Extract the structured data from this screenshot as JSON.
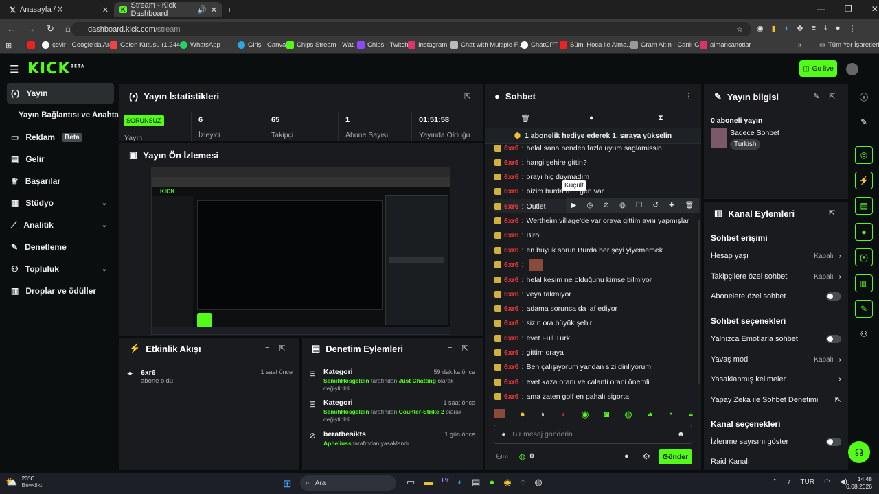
{
  "browser": {
    "tabs": [
      {
        "label": "Anasayfa / X"
      },
      {
        "label": "Stream - Kick Dashboard"
      }
    ],
    "url_domain": "dashboard.kick.com",
    "url_path": "/stream",
    "bookmarks": [
      "çevir - Google'da Ara",
      "Gelen Kutusu (1.244...",
      "WhatsApp",
      "Giriş - Canva",
      "Chips Stream - Wat...",
      "Chips - Twitch",
      "Instagram",
      "Chat with Multiple F...",
      "ChatGPT",
      "Sümi Hoca ile Alma...",
      "Gram Altın - Canlı G...",
      "almancanotlar"
    ],
    "bookmarks_right": "Tüm Yer İşaretleri"
  },
  "header": {
    "logo": "KICK",
    "logo_sup": "BETA",
    "go_live": "Go live"
  },
  "sidebar": {
    "items": [
      {
        "label": "Yayın"
      },
      {
        "label": "Yayın Bağlantısı ve Anahtarı"
      },
      {
        "label": "Reklam",
        "badge": "Beta"
      },
      {
        "label": "Gelir"
      },
      {
        "label": "Başarılar"
      },
      {
        "label": "Stüdyo"
      },
      {
        "label": "Analitik"
      },
      {
        "label": "Denetleme"
      },
      {
        "label": "Topluluk"
      },
      {
        "label": "Droplar ve ödüller"
      }
    ]
  },
  "stats": {
    "title": "Yayın İstatistikleri",
    "status_badge": "SORUNSUZ",
    "status_label": "Yayın",
    "items": [
      {
        "value": "6",
        "label": "İzleyici"
      },
      {
        "value": "65",
        "label": "Takipçi"
      },
      {
        "value": "1",
        "label": "Abone Sayısı"
      },
      {
        "value": "01:51:58",
        "label": "Yayında Olduğu"
      }
    ]
  },
  "preview": {
    "title": "Yayın Ön İzlemesi"
  },
  "activity": {
    "title": "Etkinlik Akışı",
    "items": [
      {
        "user": "6xr6",
        "action": "abone oldu",
        "time": "1 saat önce"
      }
    ]
  },
  "moderation": {
    "title": "Denetim Eylemleri",
    "items": [
      {
        "title": "Kategori",
        "time": "59 dakika önce",
        "actor": "SemihHosgeldin",
        "mid": "tarafından",
        "target": "Just Chatting",
        "rest": "olarak",
        "last": "değiştirildi"
      },
      {
        "title": "Kategori",
        "time": "1 saat önce",
        "actor": "SemihHosgeldin",
        "mid": "tarafından",
        "target": "Counter-Strike 2",
        "rest": "olarak",
        "last": "değiştirildi"
      },
      {
        "title": "beratbesikts",
        "time": "1 gün önce",
        "actor": "Apheliuss",
        "mid": "tarafından yasaklandı",
        "target": "",
        "rest": "",
        "last": ""
      }
    ]
  },
  "chat": {
    "title": "Sohbet",
    "pinned": "1 abonelik hediye ederek 1. sıraya yükselin",
    "tooltip": "Küçült",
    "messages": [
      {
        "user": "6xr6",
        "text": "helal sana benden fazla uyum saglamissin"
      },
      {
        "user": "6xr6",
        "text": "hangi şehire gittin?"
      },
      {
        "user": "6xr6",
        "text": "orayı hiç duymadım"
      },
      {
        "user": "6xr6",
        "text": "bizim burda m... gen var"
      },
      {
        "user": "6xr6",
        "text": "Outlet"
      },
      {
        "user": "6xr6",
        "text": "Wertheim village'de var oraya gittim aynı yapmışlar"
      },
      {
        "user": "6xr6",
        "text": "Birol"
      },
      {
        "user": "6xr6",
        "text": "en büyük sorun Burda her şeyi yiyememek"
      },
      {
        "user": "6xr6",
        "text": ""
      },
      {
        "user": "6xr6",
        "text": "helal kesim ne olduğunu kimse bilmiyor"
      },
      {
        "user": "6xr6",
        "text": "veya takmıyor"
      },
      {
        "user": "6xr6",
        "text": "adama sorunca da laf ediyor"
      },
      {
        "user": "6xr6",
        "text": "sizin ora büyük şehir"
      },
      {
        "user": "6xr6",
        "text": "evet Full Türk"
      },
      {
        "user": "6xr6",
        "text": "gittim oraya"
      },
      {
        "user": "6xr6",
        "text": "Ben çalışıyorum yandan sizi dinliyorum"
      },
      {
        "user": "6xr6",
        "text": "evet kaza oranı ve calanti orani önemli"
      },
      {
        "user": "6xr6",
        "text": "ama zaten golf en pahalı sigorta"
      }
    ],
    "input_placeholder": "Bir mesaj gönderin",
    "points": "0",
    "send": "Gönder"
  },
  "info": {
    "title": "Yayın bilgisi",
    "subs": "0 aboneli yayın",
    "stream_title": "Sadece Sohbet",
    "language": "Turkish"
  },
  "actions": {
    "title": "Kanal Eylemleri",
    "chat_access": "Sohbet erişimi",
    "rows1": [
      {
        "label": "Hesap yaşı",
        "value": "Kapalı",
        "kind": "chev"
      },
      {
        "label": "Takipçilere özel sohbet",
        "value": "Kapalı",
        "kind": "chev"
      },
      {
        "label": "Abonelere özel sohbet",
        "value": "",
        "kind": "toggle"
      }
    ],
    "chat_options": "Sohbet seçenekleri",
    "rows2": [
      {
        "label": "Yalnızca Emotlarla sohbet",
        "value": "",
        "kind": "toggle"
      },
      {
        "label": "Yavaş mod",
        "value": "Kapalı",
        "kind": "chev"
      },
      {
        "label": "Yasaklanmış kelimeler",
        "value": "",
        "kind": "chev"
      },
      {
        "label": "Yapay Zeka ile Sohbet Denetimi",
        "value": "",
        "kind": "ext"
      }
    ],
    "channel_options": "Kanal seçenekleri",
    "rows3": [
      {
        "label": "İzlenme sayısını göster",
        "value": "",
        "kind": "toggle"
      },
      {
        "label": "Raid Kanalı",
        "value": "",
        "kind": "none"
      }
    ]
  },
  "taskbar": {
    "temp": "23°C",
    "weather": "Bewölkt",
    "search": "Ara",
    "lang": "TUR",
    "time": "14:48",
    "date": "6.08.2026"
  },
  "colors": {
    "accent": "#53fc18",
    "panel": "#191b1f",
    "bg": "#0b0e0f",
    "username": "#f23a3a"
  }
}
